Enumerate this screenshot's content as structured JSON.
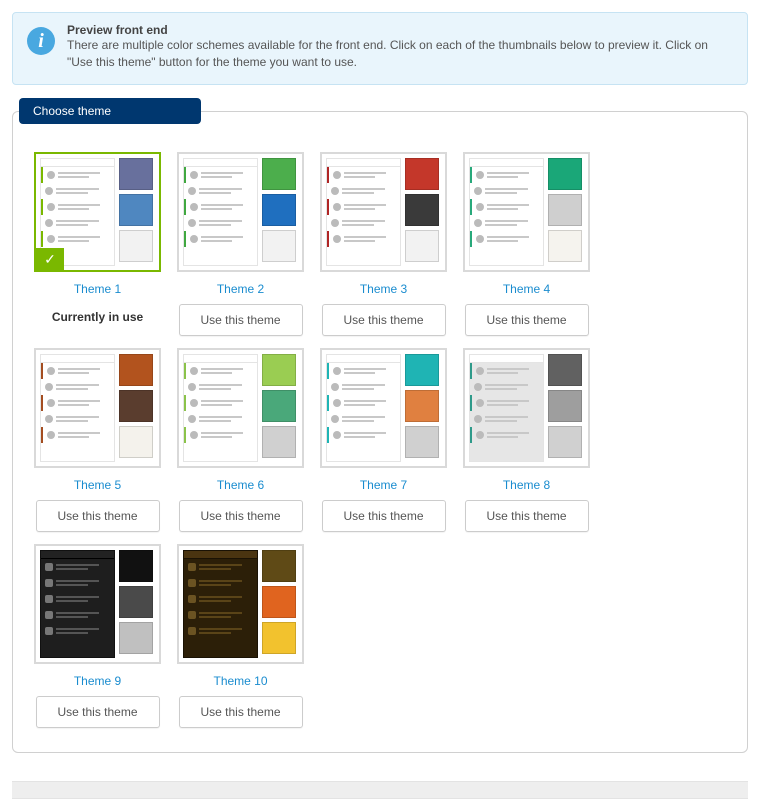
{
  "info": {
    "title": "Preview front end",
    "body": "There are multiple color schemes available for the front end. Click on each of the thumbnails below to preview it. Click on \"Use this theme\" button for the theme you want to use."
  },
  "panel": {
    "legend": "Choose theme",
    "current_label": "Currently in use",
    "use_label": "Use this theme"
  },
  "themes": [
    {
      "name": "Theme 1",
      "current": true,
      "mock": "light",
      "accent": "#7ab800",
      "swatches": [
        "#68709d",
        "#4f87c0",
        "#f2f2f2"
      ]
    },
    {
      "name": "Theme 2",
      "current": false,
      "mock": "light",
      "accent": "#40a840",
      "swatches": [
        "#4cae4c",
        "#1f6fbf",
        "#f2f2f2"
      ]
    },
    {
      "name": "Theme 3",
      "current": false,
      "mock": "light",
      "accent": "#b02626",
      "swatches": [
        "#c4372a",
        "#3a3a3a",
        "#f2f2f2"
      ]
    },
    {
      "name": "Theme 4",
      "current": false,
      "mock": "light",
      "accent": "#28a97b",
      "swatches": [
        "#1aa778",
        "#cfcfcf",
        "#f5f3ee"
      ]
    },
    {
      "name": "Theme 5",
      "current": false,
      "mock": "light",
      "accent": "#a44d20",
      "swatches": [
        "#b2531e",
        "#5a3d2e",
        "#f4f2ec"
      ]
    },
    {
      "name": "Theme 6",
      "current": false,
      "mock": "light",
      "accent": "#8bc34a",
      "swatches": [
        "#9acd52",
        "#4aa87a",
        "#d0d0d0"
      ]
    },
    {
      "name": "Theme 7",
      "current": false,
      "mock": "light",
      "accent": "#1fb5b5",
      "swatches": [
        "#1fb4b4",
        "#e08040",
        "#d0d0d0"
      ]
    },
    {
      "name": "Theme 8",
      "current": false,
      "mock": "gray",
      "accent": "#2e9a8a",
      "swatches": [
        "#616161",
        "#9e9e9e",
        "#d0d0d0"
      ]
    },
    {
      "name": "Theme 9",
      "current": false,
      "mock": "dark",
      "accent": "#222222",
      "swatches": [
        "#111111",
        "#4a4a4a",
        "#c0c0c0"
      ]
    },
    {
      "name": "Theme 10",
      "current": false,
      "mock": "brown",
      "accent": "#4a3410",
      "swatches": [
        "#5f4a16",
        "#e0641f",
        "#f2c22e"
      ]
    }
  ]
}
